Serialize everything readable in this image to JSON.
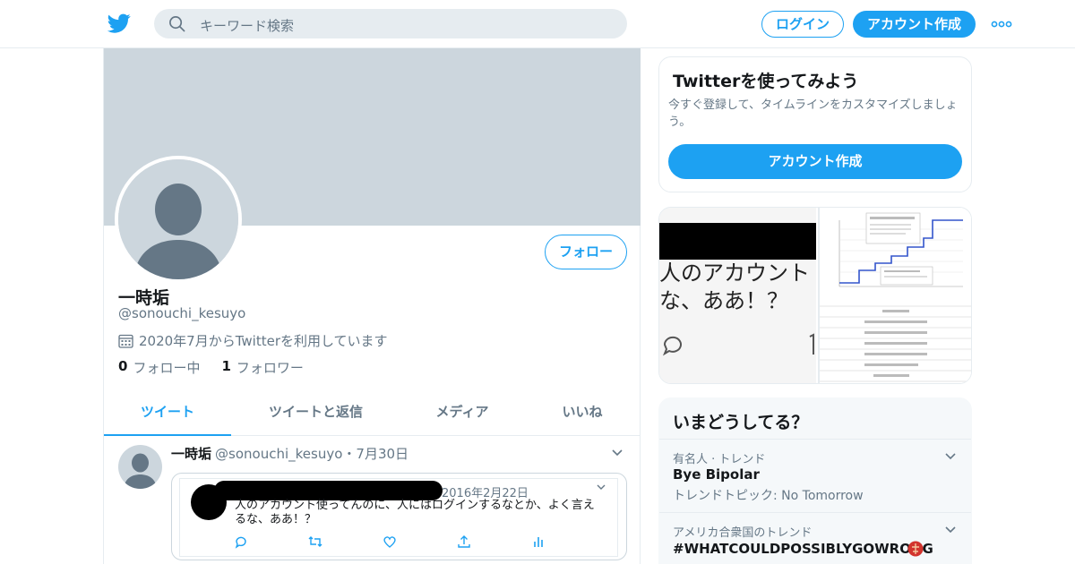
{
  "nav": {
    "search_placeholder": "キーワード検索",
    "login_label": "ログイン",
    "signup_label": "アカウント作成"
  },
  "profile": {
    "name": "一時垢",
    "handle": "@sonouchi_kesuyo",
    "joined": "2020年7月からTwitterを利用しています",
    "following_count": "0",
    "following_label": "フォロー中",
    "followers_count": "1",
    "followers_label": "フォロワー",
    "follow_button": "フォロー"
  },
  "tabs": [
    {
      "label": "ツイート"
    },
    {
      "label": "ツイートと返信"
    },
    {
      "label": "メディア"
    },
    {
      "label": "いいね"
    }
  ],
  "tweet": {
    "name": "一時垢",
    "handle": "@sonouchi_kesuyo",
    "sep": "・",
    "date": "7月30日",
    "quote": {
      "date": "2016年2月22日",
      "text": "人のアカウント使ってんのに、人にはログインするなとか、よく言えるな、ああ！？"
    }
  },
  "signup_card": {
    "title": "Twitterを使ってみよう",
    "desc": "今すぐ登録して、タイムラインをカスタマイズしましょう。",
    "button": "アカウント作成"
  },
  "media_card": {
    "text_line1": "人のアカウント",
    "text_line2": "な、ああ！？"
  },
  "trends": {
    "title": "いまどうしてる？",
    "items": [
      {
        "meta": "有名人 · トレンド",
        "name": "Bye Bipolar",
        "sub": "トレンドトピック: No Tomorrow"
      },
      {
        "meta": "アメリカ合衆国のトレンド",
        "name": "#WHATCOULDPOSSIBLYGOWRONG",
        "sub": ""
      }
    ]
  },
  "colors": {
    "accent": "#1da1f2",
    "banner": "#ccd6dd",
    "muted": "#657786"
  }
}
